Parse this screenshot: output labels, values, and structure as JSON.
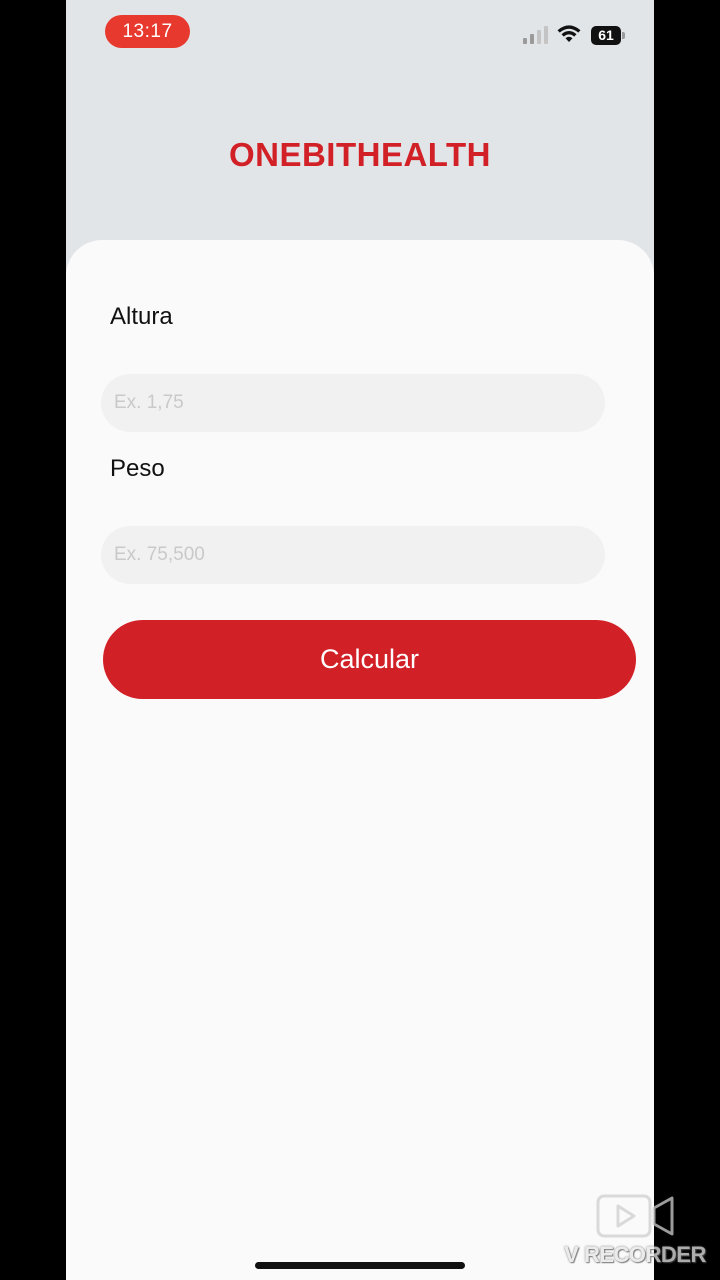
{
  "status_bar": {
    "time": "13:17",
    "battery_level": "61",
    "icons": [
      "signal-icon",
      "wifi-icon",
      "battery-icon"
    ]
  },
  "app": {
    "title": "ONEBITHEALTH"
  },
  "form": {
    "height_label": "Altura",
    "height_placeholder": "Ex. 1,75",
    "weight_label": "Peso",
    "weight_placeholder": "Ex. 75,500",
    "submit_label": "Calcular"
  },
  "watermark": {
    "text": "V RECORDER"
  },
  "colors": {
    "accent": "#d22027",
    "time_pill": "#e8392f",
    "header_bg": "#e1e5e8",
    "card_bg": "#fafafa",
    "input_bg": "#f1f1f1"
  }
}
